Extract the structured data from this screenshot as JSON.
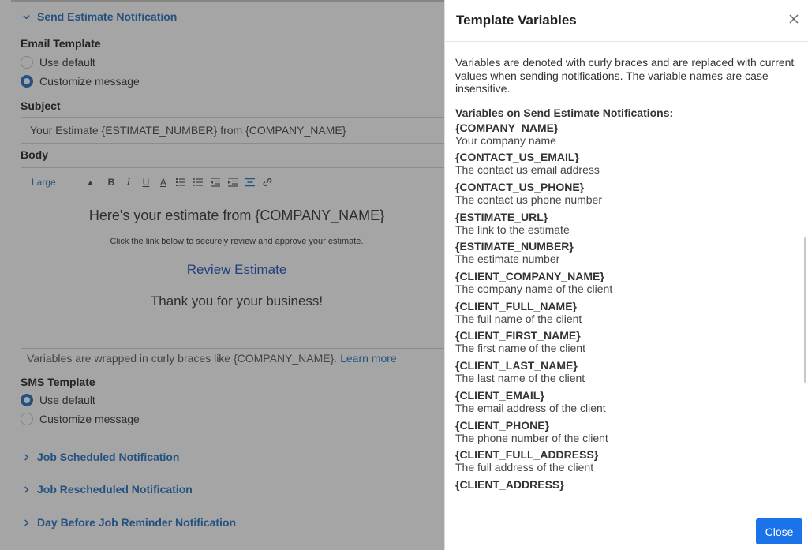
{
  "background": {
    "sections": {
      "send_estimate": "Send Estimate Notification",
      "job_scheduled": "Job Scheduled Notification",
      "job_rescheduled": "Job Rescheduled Notification",
      "day_before": "Day Before Job Reminder Notification"
    },
    "email_template": {
      "label": "Email Template",
      "use_default": "Use default",
      "customize": "Customize message"
    },
    "subject": {
      "label": "Subject",
      "value": "Your Estimate {ESTIMATE_NUMBER} from {COMPANY_NAME}"
    },
    "body": {
      "label": "Body",
      "font_size": "Large",
      "heading": "Here's your estimate from {COMPANY_NAME}",
      "small_prefix": "Click the link below ",
      "small_underlined": "to securely review and approve your estimate",
      "small_suffix": ".",
      "link": "Review Estimate",
      "thanks": "Thank you for your business!"
    },
    "variables_note": {
      "text": "Variables are wrapped in curly braces like {COMPANY_NAME}.",
      "learn_more": "Learn more"
    },
    "sms_template": {
      "label": "SMS Template",
      "use_default": "Use default",
      "customize": "Customize message"
    }
  },
  "drawer": {
    "title": "Template Variables",
    "intro": "Variables are denoted with curly braces and are replaced with current values when sending notifications. The variable names are case insensitive.",
    "section_title": "Variables on Send Estimate Notifications:",
    "variables": [
      {
        "name": "{COMPANY_NAME}",
        "desc": "Your company name"
      },
      {
        "name": "{CONTACT_US_EMAIL}",
        "desc": "The contact us email address"
      },
      {
        "name": "{CONTACT_US_PHONE}",
        "desc": "The contact us phone number"
      },
      {
        "name": "{ESTIMATE_URL}",
        "desc": "The link to the estimate"
      },
      {
        "name": "{ESTIMATE_NUMBER}",
        "desc": "The estimate number"
      },
      {
        "name": "{CLIENT_COMPANY_NAME}",
        "desc": "The company name of the client"
      },
      {
        "name": "{CLIENT_FULL_NAME}",
        "desc": "The full name of the client"
      },
      {
        "name": "{CLIENT_FIRST_NAME}",
        "desc": "The first name of the client"
      },
      {
        "name": "{CLIENT_LAST_NAME}",
        "desc": "The last name of the client"
      },
      {
        "name": "{CLIENT_EMAIL}",
        "desc": "The email address of the client"
      },
      {
        "name": "{CLIENT_PHONE}",
        "desc": "The phone number of the client"
      },
      {
        "name": "{CLIENT_FULL_ADDRESS}",
        "desc": "The full address of the client"
      },
      {
        "name": "{CLIENT_ADDRESS}",
        "desc": ""
      }
    ],
    "close_label": "Close"
  },
  "colors": {
    "accent": "#1f6fbf",
    "button": "#1a73e8",
    "overlay": "rgba(40,40,40,0.42)"
  }
}
